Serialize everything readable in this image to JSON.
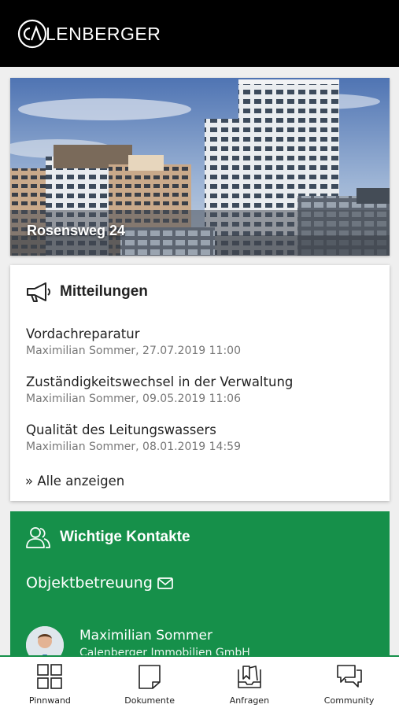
{
  "app": {
    "brand_name": "LENBERGER",
    "brand_mark_text": "CA"
  },
  "property": {
    "name": "Rosensweg 24"
  },
  "messages": {
    "title": "Mitteilungen",
    "items": [
      {
        "title": "Vordachreparatur",
        "meta": "Maximilian Sommer, 27.07.2019 11:00"
      },
      {
        "title": "Zuständigkeitswechsel in der Verwaltung",
        "meta": "Maximilian Sommer, 09.05.2019 11:06"
      },
      {
        "title": "Qualität des Leitungswassers",
        "meta": "Maximilian Sommer, 08.01.2019 14:59"
      }
    ],
    "show_all_label": "» Alle anzeigen"
  },
  "contacts": {
    "title": "Wichtige Kontakte",
    "category_label": "Objektbetreuung",
    "person_name": "Maximilian Sommer",
    "person_company": "Calenberger Immobilien GmbH"
  },
  "nav": {
    "items": [
      {
        "label": "Pinnwand",
        "icon": "grid-icon"
      },
      {
        "label": "Dokumente",
        "icon": "document-icon"
      },
      {
        "label": "Anfragen",
        "icon": "inbox-icon"
      },
      {
        "label": "Community",
        "icon": "chat-icon"
      }
    ]
  },
  "colors": {
    "header_bg": "#000000",
    "accent_green": "#16904a",
    "page_bg": "#efefef"
  }
}
